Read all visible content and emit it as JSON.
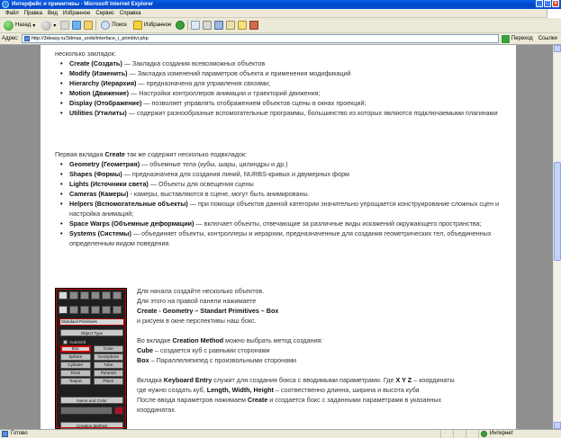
{
  "window": {
    "title": "Интерфейс и примитивы - Microsoft Internet Explorer"
  },
  "menu": [
    "Файл",
    "Правка",
    "Вид",
    "Избранное",
    "Сервис",
    "Справка"
  ],
  "toolbar": {
    "back_label": "Назад",
    "search_label": "Поиск",
    "favorites_label": "Избранное"
  },
  "address": {
    "label": "Адрес:",
    "url": "http://3deasy.ru/3dmax_uroki/interface_i_primitivi.php",
    "go_label": "Переход",
    "links_label": "Ссылки"
  },
  "content": {
    "intro_tail": "несколько закладок:",
    "tabs": [
      {
        "name": "Create (Создать)",
        "desc": " — Закладка создания всевозможных объектов"
      },
      {
        "name": "Modify (Изменить)",
        "desc": " — Закладка изменений параметров объекта и применения модификаций"
      },
      {
        "name": "Hierarchy (Иерархия)",
        "desc": " — предназначена для управления связями;"
      },
      {
        "name": "Motion (Движение)",
        "desc": " — Настройки контроллеров анимации и траекторий движения;"
      },
      {
        "name": "Display (Отображение)",
        "desc": " — позволяет управлять отображением объектов сцены в окнах проекций;"
      },
      {
        "name": "Utilities (Утилиты)",
        "desc": " — содержит разнообразные вспомогательные программы, большинство из которых являются подключаемыми плагинами"
      }
    ],
    "create_intro_a": "Первая вкладка ",
    "create_intro_b": "Create",
    "create_intro_c": " так же содержит несколько подвкладок:",
    "subtabs": [
      {
        "name": "Geometry (Геометрия)",
        "desc": " — объемные тела (кубы, шары, цилиндры и др.)"
      },
      {
        "name": "Shapes (Формы)",
        "desc": " — предназначена для создания линий, NURBS-кривых и двумерных форм"
      },
      {
        "name": "Lights (Источники света)",
        "desc": " — Объекты для освещения сцены"
      },
      {
        "name": "Cameras (Камеры)",
        "desc": " - камеры, выставляются в сцене, могут быть анимированы."
      },
      {
        "name": "Helpers (Вспомогательные объекты)",
        "desc": " — при помощи объектов данной категории значительно упрощается конструирование сложных сцен и настройка анимаций;"
      },
      {
        "name": "Space Warps (Объемные деформации)",
        "desc": " — включает объекты, отвечающие за различные виды искажений окружающего пространства;"
      },
      {
        "name": "Systems (Системы)",
        "desc": " — объединяет объекты, контроллеры и иерархии, предназначенные для создания геометрических тел, объединенных определенным видом поведения."
      }
    ],
    "side_line1": "Для начала создайте несколько объектов.",
    "side_line2": "Для этого на правой панели нажимаете",
    "side_line3": "Create - Geometry – Standart Primitives – Box",
    "side_line4": "и рисуем в окне перспективы наш бокс.",
    "method_a": "Во вкладке ",
    "method_b": "Creation Method",
    "method_c": " можно выбрать метод создания:",
    "cube_b": "Cube",
    "cube_t": " – создается куб с равными сторонами",
    "box_b": "Box",
    "box_t": " – Параллелипипед с произвольными сторонами",
    "kbd_a": "Вкладка ",
    "kbd_b": "Keyboard Entry",
    "kbd_c": " служит для создания бокса с вводимыми параметрами. Где ",
    "kbd_d": "X Y Z",
    "kbd_e": " – координаты",
    "kbd2_a": "где нужно создать куб, ",
    "kbd2_b": "Length, Width, Height",
    "kbd2_c": " – соотвественно длинна, ширина и высота куба",
    "kbd3_a": "После ввода параметров нажимаем ",
    "kbd3_b": "Create",
    "kbd3_c": " и создается бокс с заданными параметрами в указанных",
    "kbd4": "координатах."
  },
  "maxpanel": {
    "dropdown": "Standard Primitives",
    "object_type": "Object Type",
    "autogrid": "AutoGrid",
    "buttons": [
      "Box",
      "Cone",
      "Sphere",
      "GeoSphere",
      "Cylinder",
      "Tube",
      "Torus",
      "Pyramid",
      "Teapot",
      "Plane"
    ],
    "name_color": "Name and Color",
    "creation_method": "Creation Method"
  },
  "status": {
    "left": "Готово",
    "zone": "Интернет"
  }
}
